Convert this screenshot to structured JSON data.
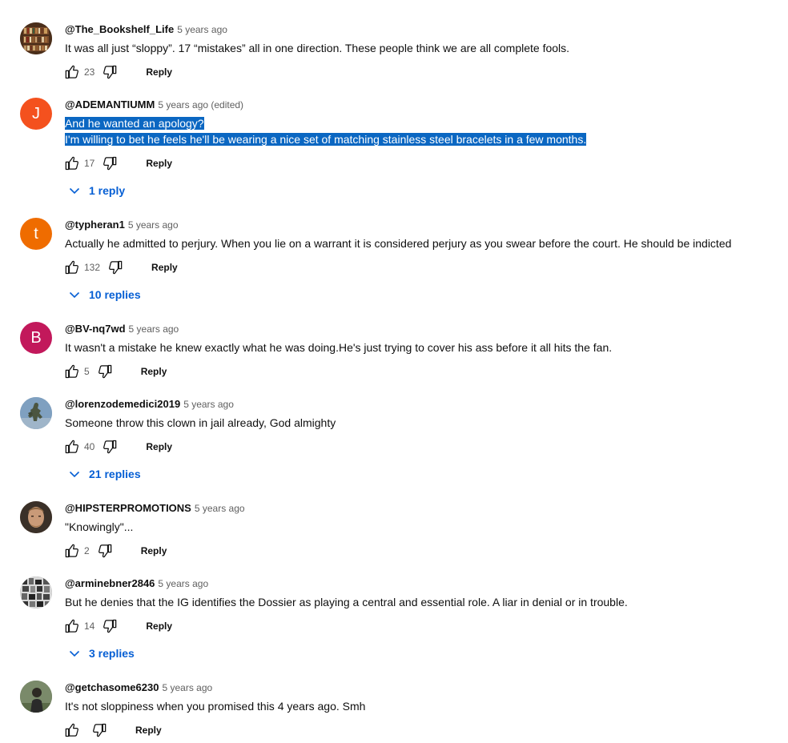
{
  "reply_label": "Reply",
  "comments": [
    {
      "author": "@The_Bookshelf_Life",
      "time": "5 years ago",
      "lines": [
        "It was all just “sloppy”.  17 “mistakes” all in one direction.  These people think we are all complete fools."
      ],
      "likes": "23",
      "avatar": {
        "kind": "image",
        "icon": "bookshelf-avatar",
        "color": "#5b3a22"
      }
    },
    {
      "author": "@ADEMANTIUMM",
      "time": "5 years ago (edited)",
      "lines": [
        "And he wanted an apology?",
        "I'm willing to bet he feels he'll be wearing a nice set of matching stainless steel bracelets in a few months."
      ],
      "selected": true,
      "likes": "17",
      "replies": "1 reply",
      "avatar": {
        "kind": "letter",
        "letter": "J",
        "color": "#f4511e"
      }
    },
    {
      "author": "@typheran1",
      "time": "5 years ago",
      "lines": [
        "Actually he admitted to perjury. When you lie on a warrant it is considered perjury as you swear before the court. He should be indicted"
      ],
      "likes": "132",
      "replies": "10 replies",
      "avatar": {
        "kind": "letter",
        "letter": "t",
        "color": "#ef6c00"
      }
    },
    {
      "author": "@BV-nq7wd",
      "time": "5 years ago",
      "lines": [
        "It wasn't a mistake he knew exactly what he was doing.He's just trying to cover his ass before it all hits the fan."
      ],
      "likes": "5",
      "avatar": {
        "kind": "letter",
        "letter": "B",
        "color": "#c2185b"
      }
    },
    {
      "author": "@lorenzodemedici2019",
      "time": "5 years ago",
      "lines": [
        "Someone throw this clown in jail already, God almighty"
      ],
      "likes": "40",
      "replies": "21 replies",
      "avatar": {
        "kind": "image",
        "icon": "statue-avatar",
        "color": "#6f8fae"
      }
    },
    {
      "author": "@HIPSTERPROMOTIONS",
      "time": "5 years ago",
      "lines": [
        "\"Knowingly\"..."
      ],
      "likes": "2",
      "avatar": {
        "kind": "image",
        "icon": "face-avatar",
        "color": "#8a6a50"
      }
    },
    {
      "author": "@arminebner2846",
      "time": "5 years ago",
      "lines": [
        "But he denies that the IG identifies the Dossier as playing a central and essential role.  A liar in denial or in trouble."
      ],
      "likes": "14",
      "replies": "3 replies",
      "avatar": {
        "kind": "image",
        "icon": "collage-avatar",
        "color": "#777777"
      }
    },
    {
      "author": "@getchasome6230",
      "time": "5 years ago",
      "lines": [
        "It's not sloppiness when you promised this 4 years ago. Smh"
      ],
      "likes": "",
      "avatar": {
        "kind": "image",
        "icon": "person-avatar",
        "color": "#4d5a3a"
      }
    }
  ]
}
